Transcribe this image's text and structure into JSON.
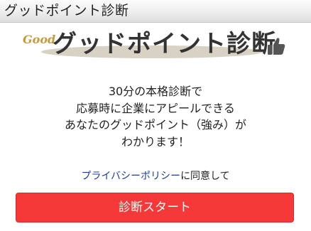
{
  "window": {
    "title": "グッドポイント診断"
  },
  "logo": {
    "good_text": "Good",
    "main_text": "グッドポイント診断",
    "icon": "thumbs-up-icon"
  },
  "description": {
    "lines": [
      "30分の本格診断で",
      "応募時に企業にアピールできる",
      "あなたのグッドポイント（強み）が",
      "わかります！"
    ]
  },
  "privacy": {
    "link_text": "プライバシーポリシー",
    "suffix": "に同意して"
  },
  "start_button": {
    "label": "診断スタート"
  },
  "colors": {
    "button": "#f53838",
    "link": "#1a3fa0",
    "logo_accent": "#c49a3c"
  }
}
